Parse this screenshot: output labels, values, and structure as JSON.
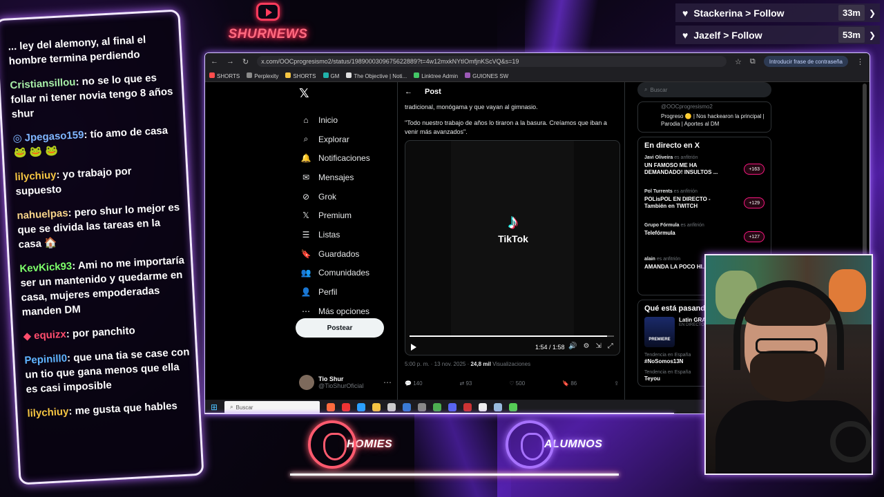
{
  "brand": {
    "name": "SHURNEWS"
  },
  "chat": {
    "messages": [
      {
        "user": "",
        "color": "#ffffff",
        "text": "... ley del alemony, al final el hombre termina perdiendo",
        "icon": ""
      },
      {
        "user": "Cristiansillou",
        "color": "#a8f0a8",
        "text": ": no se lo que es follar ni tener novia tengo 8 años shur",
        "icon": ""
      },
      {
        "user": "Jpegaso159",
        "color": "#7fb6ff",
        "text": ": tío amo de casa 🐸 🐸 🐸",
        "icon": "◎"
      },
      {
        "user": "lilychiuy",
        "color": "#f5c542",
        "text": ": yo trabajo por supuesto",
        "icon": ""
      },
      {
        "user": "nahuelpas",
        "color": "#f7d48a",
        "text": ": pero shur lo mejor es que se divida las tareas en la casa 🏠",
        "icon": ""
      },
      {
        "user": "KevKick93",
        "color": "#7dff6a",
        "text": ": Ami no me importaría ser un mantenido y quedarme en casa, mujeres empoderadas manden DM",
        "icon": ""
      },
      {
        "user": "equizx",
        "color": "#ff4d6d",
        "text": ": por panchito",
        "icon": "◆"
      },
      {
        "user": "Pepinill0",
        "color": "#5fb4ff",
        "text": ": que una tia se case con un tio que gana menos que ella es casi imposible",
        "icon": ""
      },
      {
        "user": "lilychiuy",
        "color": "#f5c542",
        "text": ": me gusta que hables",
        "icon": ""
      }
    ]
  },
  "follows": [
    {
      "name": "Stackerina",
      "action": "> Follow",
      "time": "33m"
    },
    {
      "name": "Jazelf",
      "action": "> Follow",
      "time": "53m"
    }
  ],
  "browser": {
    "url": "x.com/OOCprogresismo2/status/1989000309675622889?t=4w12mxkNYtIOmfjnKScVQ&s=19",
    "password_prompt": "Introducir frase de contraseña",
    "bookmarks": [
      "SHORTS",
      "Perplexity",
      "SHORTS",
      "GM",
      "The Objective | Noti...",
      "Linktree Admin",
      "GUIONES SW"
    ]
  },
  "x": {
    "logo": "𝕏",
    "nav": [
      {
        "icon": "⌂",
        "label": "Inicio"
      },
      {
        "icon": "⌕",
        "label": "Explorar"
      },
      {
        "icon": "🔔",
        "label": "Notificaciones"
      },
      {
        "icon": "✉",
        "label": "Mensajes"
      },
      {
        "icon": "⊘",
        "label": "Grok"
      },
      {
        "icon": "𝕏",
        "label": "Premium"
      },
      {
        "icon": "☰",
        "label": "Listas"
      },
      {
        "icon": "🔖",
        "label": "Guardados"
      },
      {
        "icon": "👥",
        "label": "Comunidades"
      },
      {
        "icon": "👤",
        "label": "Perfil"
      },
      {
        "icon": "⋯",
        "label": "Más opciones"
      }
    ],
    "post_button": "Postear",
    "profile": {
      "name": "Tio Shur",
      "handle": "@TioShurOficial"
    },
    "post": {
      "header": "Post",
      "text_top": "tradicional, monógama y que vayan al gimnasio.",
      "text_quote": "\"Todo nuestro trabajo de años lo tiraron a la basura. Creíamos que iban a venir más avanzados\".",
      "video_brand": "TikTok",
      "time": "1:54 / 1:58",
      "progress": 0.966,
      "date": "5:00 p. m. · 13 nov. 2025 ·",
      "views": "24,8 mil",
      "views_label": "Visualizaciones",
      "replies": "140",
      "reposts": "93",
      "likes": "500",
      "bookmarks": "86"
    },
    "right": {
      "search_placeholder": "Buscar",
      "promo_handle": "@OOCprogresismo2",
      "promo_text": "Progreso 🟡 | Nos hackearon la principal | Parodia | Aportes al DM",
      "live_title": "En directo en X",
      "live": [
        {
          "host": "Javi Oliveira",
          "role": "es anfitrión",
          "title": "UN FAMOSO ME HA DEMANDADO! INSULTOS ...",
          "count": "+163"
        },
        {
          "host": "Pol Turrents",
          "role": "es anfitrión",
          "title": "POLisPOL EN DIRECTO - También en TWITCH",
          "count": "+129"
        },
        {
          "host": "Grupo Fórmula",
          "role": "es anfitrión",
          "title": "Telefórmula",
          "count": "+127"
        },
        {
          "host": "alain",
          "role": "es anfitrión",
          "title": "AMANDA LA POCO HI... 3",
          "count": ""
        }
      ],
      "trend_title": "Qué está pasando",
      "trend_card": {
        "thumb": "PREMIERE",
        "name": "Latin GRA...",
        "sub": "EN DIRECTO"
      },
      "trends": [
        {
          "context": "Tendencia en España",
          "tag": "#NoSomos13N"
        },
        {
          "context": "Tendencia en España",
          "tag": "Teyou"
        }
      ]
    }
  },
  "taskbar": {
    "search_placeholder": "Buscar"
  },
  "badges": [
    {
      "label": "HOMIES",
      "color": "#ff5a6e"
    },
    {
      "label": "ALUMNOS",
      "color": "#a772ff"
    }
  ]
}
